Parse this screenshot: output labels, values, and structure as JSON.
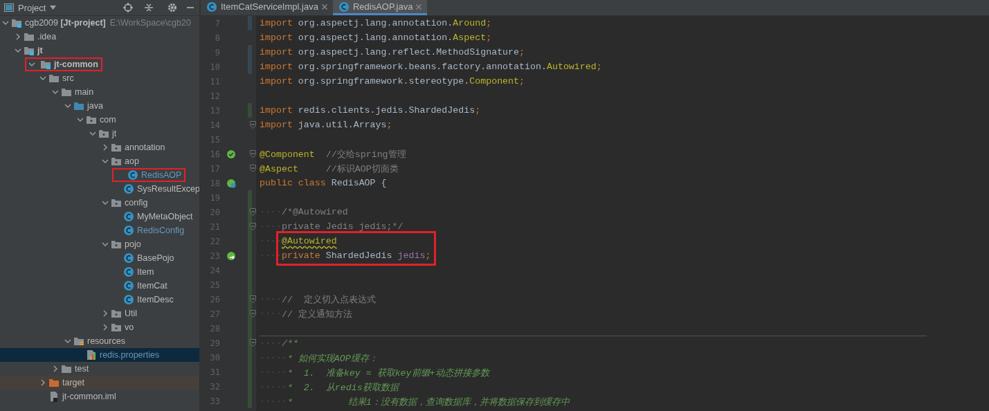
{
  "project_panel": {
    "title": "Project",
    "tree": [
      {
        "label": "cgb2009",
        "bold_part": "[Jt-project]",
        "path": "E:\\WorkSpace\\cgb20",
        "kind": "module",
        "expanded": true,
        "selected": false,
        "children": [
          {
            "label": ".idea",
            "kind": "folder",
            "expanded": false,
            "selected": false
          },
          {
            "label": "jt",
            "kind": "module",
            "bold": true,
            "expanded": true,
            "selected": false,
            "children": [
              {
                "label": "jt-common",
                "kind": "module",
                "bold": true,
                "expanded": true,
                "selected": false,
                "highlighted": true,
                "children": [
                  {
                    "label": "src",
                    "kind": "folder",
                    "expanded": true,
                    "selected": false,
                    "children": [
                      {
                        "label": "main",
                        "kind": "folder",
                        "expanded": true,
                        "selected": false,
                        "children": [
                          {
                            "label": "java",
                            "kind": "source-folder",
                            "expanded": true,
                            "selected": false,
                            "children": [
                              {
                                "label": "com",
                                "kind": "package",
                                "expanded": true,
                                "selected": false,
                                "children": [
                                  {
                                    "label": "jt",
                                    "kind": "package",
                                    "expanded": true,
                                    "selected": false,
                                    "children": [
                                      {
                                        "label": "annotation",
                                        "kind": "package",
                                        "expanded": false,
                                        "selected": false
                                      },
                                      {
                                        "label": "aop",
                                        "kind": "package",
                                        "expanded": true,
                                        "selected": false,
                                        "children": [
                                          {
                                            "label": "RedisAOP",
                                            "kind": "class",
                                            "modified": true,
                                            "selected": false,
                                            "highlighted": true
                                          },
                                          {
                                            "label": "SysResultExcep",
                                            "kind": "class",
                                            "modified": false,
                                            "selected": false
                                          }
                                        ]
                                      },
                                      {
                                        "label": "config",
                                        "kind": "package",
                                        "expanded": true,
                                        "selected": false,
                                        "children": [
                                          {
                                            "label": "MyMetaObject",
                                            "kind": "class",
                                            "modified": false,
                                            "selected": false
                                          },
                                          {
                                            "label": "RedisConfig",
                                            "kind": "class",
                                            "modified": true,
                                            "selected": false
                                          }
                                        ]
                                      },
                                      {
                                        "label": "pojo",
                                        "kind": "package",
                                        "expanded": true,
                                        "selected": false,
                                        "children": [
                                          {
                                            "label": "BasePojo",
                                            "kind": "class",
                                            "modified": false,
                                            "selected": false
                                          },
                                          {
                                            "label": "Item",
                                            "kind": "class",
                                            "modified": false,
                                            "selected": false
                                          },
                                          {
                                            "label": "ItemCat",
                                            "kind": "class",
                                            "modified": false,
                                            "selected": false
                                          },
                                          {
                                            "label": "ItemDesc",
                                            "kind": "class",
                                            "modified": false,
                                            "selected": false
                                          }
                                        ]
                                      },
                                      {
                                        "label": "Util",
                                        "kind": "package",
                                        "expanded": false,
                                        "selected": false
                                      },
                                      {
                                        "label": "vo",
                                        "kind": "package",
                                        "expanded": false,
                                        "selected": false
                                      }
                                    ]
                                  }
                                ]
                              }
                            ]
                          },
                          {
                            "label": "resources",
                            "kind": "resource-folder",
                            "expanded": true,
                            "selected": false,
                            "children": [
                              {
                                "label": "redis.properties",
                                "kind": "properties",
                                "modified": true,
                                "selected": true
                              }
                            ]
                          }
                        ]
                      },
                      {
                        "label": "test",
                        "kind": "folder",
                        "expanded": false,
                        "selected": false
                      }
                    ]
                  },
                  {
                    "label": "target",
                    "kind": "excluded-folder",
                    "expanded": false,
                    "selected": false
                  },
                  {
                    "label": "jt-common.iml",
                    "kind": "iml",
                    "selected": false
                  }
                ]
              }
            ]
          }
        ]
      }
    ]
  },
  "editor_tabs": [
    {
      "label": "ItemCatServiceImpl.java",
      "selected": false
    },
    {
      "label": "RedisAOP.java",
      "selected": true
    }
  ],
  "code_lines": [
    {
      "number": "7",
      "modified": true,
      "added": false,
      "fold": false,
      "tokens": [
        {
          "kind": "kw",
          "text": "import"
        },
        {
          "kind": "plain",
          "text": " org.aspectj.lang.annotation."
        },
        {
          "kind": "ann",
          "text": "Around"
        },
        {
          "kind": "kw",
          "text": ";"
        }
      ]
    },
    {
      "number": "8",
      "modified": false,
      "added": false,
      "fold": false,
      "tokens": [
        {
          "kind": "kw",
          "text": "import"
        },
        {
          "kind": "plain",
          "text": " org.aspectj.lang.annotation."
        },
        {
          "kind": "ann",
          "text": "Aspect"
        },
        {
          "kind": "kw",
          "text": ";"
        }
      ]
    },
    {
      "number": "9",
      "modified": true,
      "added": false,
      "fold": false,
      "tokens": [
        {
          "kind": "kw",
          "text": "import"
        },
        {
          "kind": "plain",
          "text": " org.aspectj.lang.reflect.MethodSignature"
        },
        {
          "kind": "kw",
          "text": ";"
        }
      ]
    },
    {
      "number": "10",
      "modified": true,
      "added": false,
      "fold": false,
      "tokens": [
        {
          "kind": "kw",
          "text": "import"
        },
        {
          "kind": "plain",
          "text": " org.springframework.beans.factory.annotation."
        },
        {
          "kind": "ann",
          "text": "Autowired"
        },
        {
          "kind": "kw",
          "text": ";"
        }
      ]
    },
    {
      "number": "11",
      "modified": false,
      "added": false,
      "fold": false,
      "tokens": [
        {
          "kind": "kw",
          "text": "import"
        },
        {
          "kind": "plain",
          "text": " org.springframework.stereotype."
        },
        {
          "kind": "ann",
          "text": "Component"
        },
        {
          "kind": "kw",
          "text": ";"
        }
      ]
    },
    {
      "number": "12",
      "modified": false,
      "added": false,
      "fold": false
    },
    {
      "number": "13",
      "modified": false,
      "added": true,
      "fold": false,
      "tokens": [
        {
          "kind": "kw",
          "text": "import"
        },
        {
          "kind": "plain",
          "text": " redis.clients.jedis.ShardedJedis"
        },
        {
          "kind": "kw",
          "text": ";"
        }
      ]
    },
    {
      "number": "14",
      "modified": false,
      "added": false,
      "fold": true,
      "tokens": [
        {
          "kind": "kw",
          "text": "import"
        },
        {
          "kind": "plain",
          "text": " java.util.Arrays"
        },
        {
          "kind": "kw",
          "text": ";"
        }
      ]
    },
    {
      "number": "15",
      "modified": false,
      "added": false,
      "fold": false
    },
    {
      "number": "16",
      "modified": false,
      "added": false,
      "fold": true,
      "gutter_icon": {
        "kind": "bean"
      },
      "tokens": [
        {
          "kind": "ann",
          "text": "@Component"
        },
        {
          "kind": "cmt",
          "text": "  //交给spring管理"
        }
      ]
    },
    {
      "number": "17",
      "modified": false,
      "added": false,
      "fold": true,
      "tokens": [
        {
          "kind": "ann",
          "text": "@Aspect"
        },
        {
          "kind": "cmt",
          "text": "     //标识AOP切面类"
        }
      ]
    },
    {
      "number": "18",
      "modified": false,
      "added": false,
      "fold": false,
      "gutter_icon": {
        "kind": "bean-class"
      },
      "tokens": [
        {
          "kind": "kw",
          "text": "public class"
        },
        {
          "kind": "plain",
          "text": " RedisAOP {"
        }
      ]
    },
    {
      "number": "19",
      "modified": false,
      "added": true,
      "fold": false
    },
    {
      "number": "20",
      "modified": false,
      "added": true,
      "fold": true,
      "tokens": [
        {
          "kind": "ws",
          "text": "····"
        },
        {
          "kind": "cmt",
          "text": "/*@Autowired"
        }
      ]
    },
    {
      "number": "21",
      "modified": false,
      "added": true,
      "fold": true,
      "tokens": [
        {
          "kind": "ws",
          "text": "····"
        },
        {
          "kind": "cmt",
          "text": "private Jedis jedis;*/"
        }
      ]
    },
    {
      "number": "22",
      "modified": false,
      "added": true,
      "fold": false,
      "boxed": true,
      "tokens": [
        {
          "kind": "ws",
          "text": "····"
        },
        {
          "kind": "warn",
          "text": "@Autowired"
        }
      ]
    },
    {
      "number": "23",
      "modified": false,
      "added": true,
      "fold": false,
      "boxed": true,
      "gutter_icon": {
        "kind": "autowired"
      },
      "tokens": [
        {
          "kind": "ws",
          "text": "····"
        },
        {
          "kind": "kw",
          "text": "private"
        },
        {
          "kind": "plain",
          "text": " ShardedJedis "
        },
        {
          "kind": "field",
          "text": "jedis"
        },
        {
          "kind": "kw",
          "text": ";"
        }
      ]
    },
    {
      "number": "24",
      "modified": false,
      "added": true,
      "fold": false
    },
    {
      "number": "25",
      "modified": false,
      "added": true,
      "fold": false
    },
    {
      "number": "26",
      "modified": false,
      "added": true,
      "fold": true,
      "tokens": [
        {
          "kind": "ws",
          "text": "····"
        },
        {
          "kind": "cmt",
          "text": "//  定义切入点表达式"
        }
      ]
    },
    {
      "number": "27",
      "modified": false,
      "added": true,
      "fold": true,
      "tokens": [
        {
          "kind": "ws",
          "text": "····"
        },
        {
          "kind": "cmt",
          "text": "// 定义通知方法"
        }
      ]
    },
    {
      "number": "28",
      "modified": false,
      "added": true,
      "fold": false
    },
    {
      "number": "29",
      "modified": false,
      "added": true,
      "fold": true,
      "separator": true,
      "tokens": [
        {
          "kind": "ws",
          "text": "····"
        },
        {
          "kind": "doc",
          "text": "/**"
        }
      ]
    },
    {
      "number": "30",
      "modified": false,
      "added": true,
      "fold": false,
      "tokens": [
        {
          "kind": "ws",
          "text": "·····"
        },
        {
          "kind": "doc",
          "text": "* 如何实现AOP缓存："
        }
      ]
    },
    {
      "number": "31",
      "modified": false,
      "added": true,
      "fold": false,
      "tokens": [
        {
          "kind": "ws",
          "text": "·····"
        },
        {
          "kind": "doc",
          "text": "*  1.  准备key = 获取key前缀+动态拼接参数"
        }
      ]
    },
    {
      "number": "32",
      "modified": false,
      "added": true,
      "fold": false,
      "tokens": [
        {
          "kind": "ws",
          "text": "·····"
        },
        {
          "kind": "doc",
          "text": "*  2.  从redis获取数据"
        }
      ]
    },
    {
      "number": "33",
      "modified": false,
      "added": true,
      "fold": false,
      "tokens": [
        {
          "kind": "ws",
          "text": "·····"
        },
        {
          "kind": "doc",
          "text": "*          结果1：没有数据，查询数据库，并将数据保存到缓存中"
        }
      ]
    }
  ]
}
